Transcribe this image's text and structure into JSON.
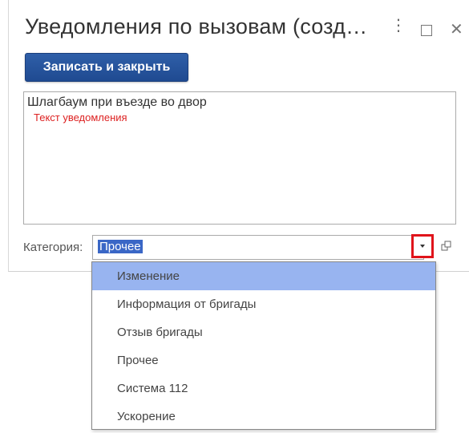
{
  "window": {
    "title": "Уведомления по вызовам (создан...",
    "more_icon": "kebab-menu-icon",
    "maximize_icon": "maximize-icon",
    "close_icon": "close-icon"
  },
  "toolbar": {
    "save_close_label": "Записать и закрыть"
  },
  "notification": {
    "text_value": "Шлагбаум при въезде во двор",
    "hint": "Текст уведомления"
  },
  "category": {
    "label": "Категория:",
    "value": "Прочее",
    "options": [
      "Изменение",
      "Информация от бригады",
      "Отзыв бригады",
      "Прочее",
      "Система 112",
      "Ускорение"
    ],
    "highlighted_option": "Изменение"
  },
  "colors": {
    "primary_button": "#2a579e",
    "highlight": "#98b4f0",
    "selection": "#3a67c6",
    "callout_border": "#e0141b",
    "hint_text": "#d22222"
  }
}
